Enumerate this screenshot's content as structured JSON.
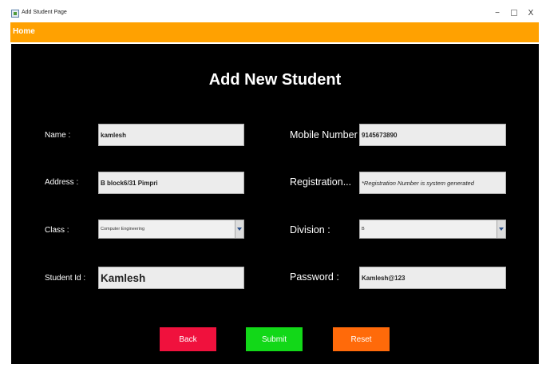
{
  "window": {
    "title": "Add Student Page",
    "minimize": "−",
    "close": "X"
  },
  "menu": {
    "home": "Home"
  },
  "heading": "Add New Student",
  "form": {
    "name": {
      "label": "Name :",
      "value": "kamlesh"
    },
    "mobile": {
      "label": "Mobile Number :",
      "value": "9145673890"
    },
    "address": {
      "label": "Address :",
      "value": "B block6/31 Pimpri"
    },
    "registration": {
      "label": "Registration...",
      "value": "*Registration Number is system generated"
    },
    "class": {
      "label": "Class :",
      "selected": "Computer Engineering"
    },
    "division": {
      "label": "Division :",
      "selected": "B"
    },
    "student_id": {
      "label": "Student Id :",
      "value": "Kamlesh"
    },
    "password": {
      "label": "Password :",
      "value": "Kamlesh@123"
    }
  },
  "buttons": {
    "back": "Back",
    "submit": "Submit",
    "reset": "Reset"
  },
  "colors": {
    "menubar": "#ffa101",
    "background": "#000000",
    "back_button": "#f0113d",
    "submit_button": "#12d818",
    "reset_button": "#ff6a0a",
    "notice_text": "#e0221b"
  }
}
